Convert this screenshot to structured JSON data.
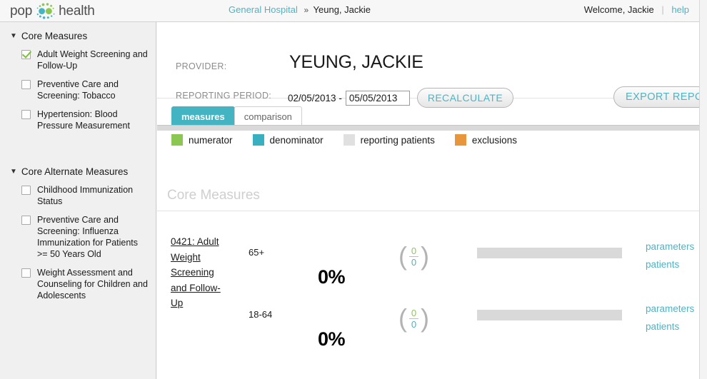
{
  "brand": {
    "logo_text_left": "pop",
    "logo_text_right": "health",
    "logo_mark_icon": "dot-circle-logo-icon",
    "green": "#8cc751",
    "teal": "#45b4c2",
    "orange": "#e8963c",
    "gray": "#d9d9d9"
  },
  "header": {
    "breadcrumb_org": "General Hospital",
    "breadcrumb_separator": "»",
    "breadcrumb_current": "Yeung, Jackie",
    "welcome": "Welcome, Jackie",
    "divider": "|",
    "help_label": "help"
  },
  "sidebar": {
    "groups": [
      {
        "title": "Core Measures",
        "caret": "▼",
        "items": [
          {
            "label": "Adult Weight Screening and Follow-Up",
            "checked": true
          },
          {
            "label": "Preventive Care and Screening: Tobacco",
            "checked": false
          },
          {
            "label": "Hypertension: Blood Pressure Measurement",
            "checked": false
          }
        ]
      },
      {
        "title": "Core Alternate Measures",
        "caret": "▼",
        "items": [
          {
            "label": "Childhood Immunization Status",
            "checked": false
          },
          {
            "label": "Preventive Care and Screening: Influenza Immunization for Patients >= 50 Years Old",
            "checked": false
          },
          {
            "label": "Weight Assessment and Counseling for Children and Adolescents",
            "checked": false
          }
        ]
      }
    ]
  },
  "main": {
    "provider_label": "PROVIDER:",
    "provider_name": "YEUNG, JACKIE",
    "period_label": "REPORTING PERIOD:",
    "period_start": "02/05/2013 -",
    "period_end_value": "05/05/2013",
    "period_end_placeholder": "mm/dd/yyyy",
    "recalculate_label": "RECALCULATE",
    "export_label": "EXPORT REPORT",
    "tabs": [
      {
        "label": "measures",
        "active": true
      },
      {
        "label": "comparison",
        "active": false
      }
    ],
    "legend": [
      {
        "label": "numerator",
        "color": "#8cc751"
      },
      {
        "label": "denominator",
        "color": "#39b0bf"
      },
      {
        "label": "reporting patients",
        "color": "#e0e0e0"
      },
      {
        "label": "exclusions",
        "color": "#e8963c"
      }
    ],
    "section_title": "Core Measures",
    "measure": {
      "title": "0421: Adult Weight Screening and Follow-Up",
      "rows": [
        {
          "age_band": "65+",
          "percent": "0%",
          "numerator": "0",
          "denominator": "0",
          "parameters_label": "parameters",
          "patients_label": "patients"
        },
        {
          "age_band": "18-64",
          "percent": "0%",
          "numerator": "0",
          "denominator": "0",
          "parameters_label": "parameters",
          "patients_label": "patients"
        }
      ]
    }
  }
}
